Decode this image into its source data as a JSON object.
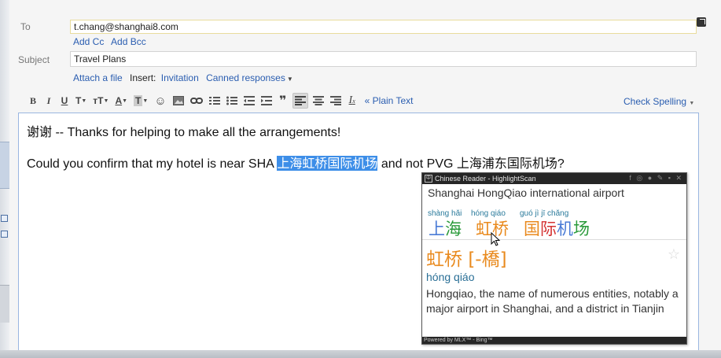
{
  "colors": {
    "link": "#2a5db0",
    "selection": "#3d8ee8",
    "tone1": "#4a7bd6",
    "tone2": "#2a9a3a",
    "tone3": "#e98a1e",
    "tone4": "#d43232"
  },
  "compose": {
    "to_label": "To",
    "to_value": "t.chang@shanghai8.com",
    "add_cc": "Add Cc",
    "add_bcc": "Add Bcc",
    "subject_label": "Subject",
    "subject_value": "Travel Plans",
    "attach": "Attach a file",
    "insert_label": "Insert:",
    "invitation": "Invitation",
    "canned": "Canned responses",
    "popout_icon": "popout-icon"
  },
  "toolbar": {
    "bold": "B",
    "italic": "I",
    "underline": "U",
    "font": "T",
    "size": "тT",
    "text_color": "A",
    "bg_color": "T",
    "plain_text": "« Plain Text",
    "check_spelling": "Check Spelling"
  },
  "body": {
    "line1_cjk": "谢谢",
    "line1_text": " -- Thanks for helping to make all the arrangements!",
    "line2_before": "Could you confirm that my hotel is near SHA ",
    "line2_selected": "上海虹桥国际机场",
    "line2_after": " and not PVG ",
    "line2_cjk": "上海浦东国际机场",
    "line2_end": "?"
  },
  "popup": {
    "title": "Chinese Reader - HighlightScan",
    "translation": "Shanghai HongQiao international airport",
    "words": [
      {
        "pinyin": "shàng hǎi",
        "chars": [
          "上",
          "海"
        ],
        "tones": [
          4,
          3
        ]
      },
      {
        "pinyin": "hóng qiáo",
        "chars": [
          "虹",
          "桥"
        ],
        "tones": [
          2,
          2
        ]
      },
      {
        "pinyin": "guó jì jī chǎng",
        "chars": [
          "国",
          "际",
          "机",
          "场"
        ],
        "tones": [
          2,
          4,
          1,
          3
        ]
      }
    ],
    "entry_word": "虹桥",
    "entry_trad": "[-橋]",
    "entry_pinyin": "hóng qiáo",
    "definition": "Hongqiao, the name of numerous entities, notably a major airport in Shanghai, and a district in Tianjin",
    "footer": "Powered by MLX™ - Bing™"
  }
}
